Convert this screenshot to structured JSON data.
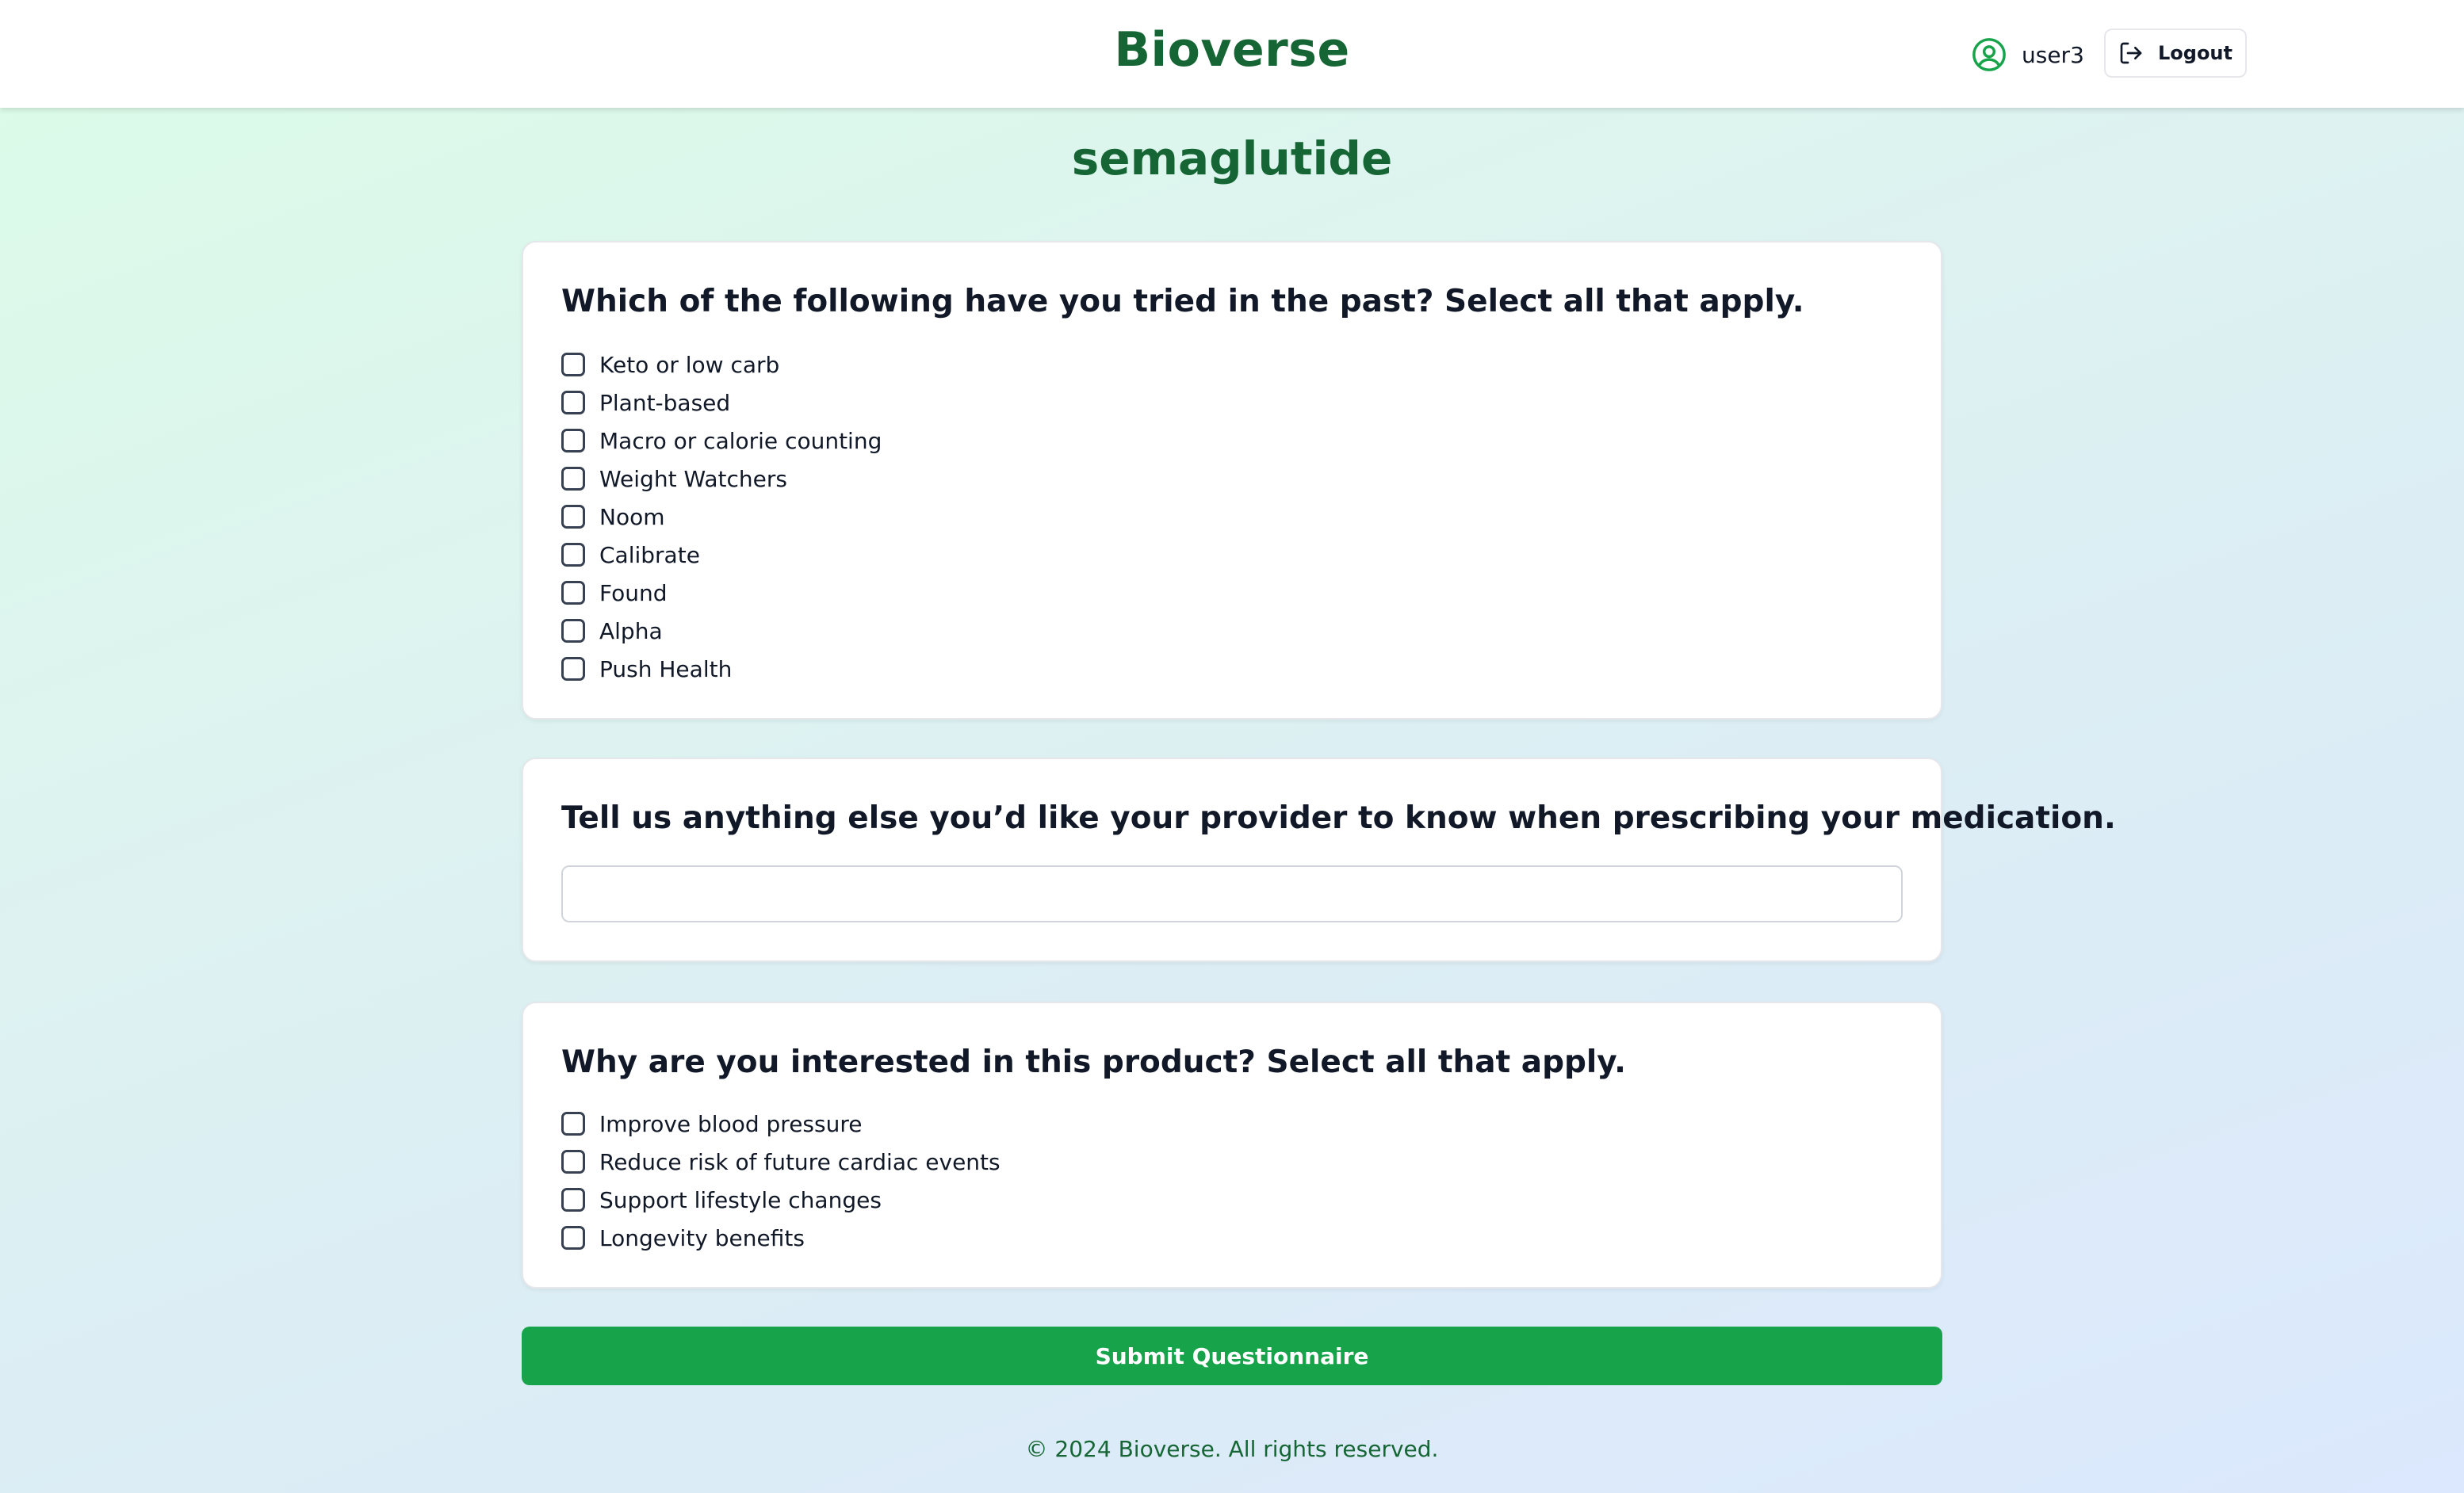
{
  "header": {
    "brand": "Bioverse",
    "user": {
      "icon": "user-circle-icon",
      "name": "user3"
    },
    "logout": {
      "icon": "logout-icon",
      "label": "Logout"
    }
  },
  "page": {
    "title": "semaglutide"
  },
  "questions": [
    {
      "type": "checkbox",
      "title": "Which of the following have you tried in the past? Select all that apply.",
      "options": [
        {
          "label": "Keto or low carb",
          "checked": false
        },
        {
          "label": "Plant-based",
          "checked": false
        },
        {
          "label": "Macro or calorie counting",
          "checked": false
        },
        {
          "label": "Weight Watchers",
          "checked": false
        },
        {
          "label": "Noom",
          "checked": false
        },
        {
          "label": "Calibrate",
          "checked": false
        },
        {
          "label": "Found",
          "checked": false
        },
        {
          "label": "Alpha",
          "checked": false
        },
        {
          "label": "Push Health",
          "checked": false
        }
      ]
    },
    {
      "type": "text",
      "title": "Tell us anything else you’d like your provider to know when prescribing your medication.",
      "value": "",
      "placeholder": ""
    },
    {
      "type": "checkbox",
      "title": "Why are you interested in this product? Select all that apply.",
      "options": [
        {
          "label": "Improve blood pressure",
          "checked": false
        },
        {
          "label": "Reduce risk of future cardiac events",
          "checked": false
        },
        {
          "label": "Support lifestyle changes",
          "checked": false
        },
        {
          "label": "Longevity benefits",
          "checked": false
        }
      ]
    }
  ],
  "submit": {
    "label": "Submit Questionnaire"
  },
  "footer": {
    "text": "© 2024 Bioverse. All rights reserved."
  },
  "colors": {
    "brand_green": "#166534",
    "button_green": "#16a34a",
    "user_icon_green": "#16a34a"
  }
}
